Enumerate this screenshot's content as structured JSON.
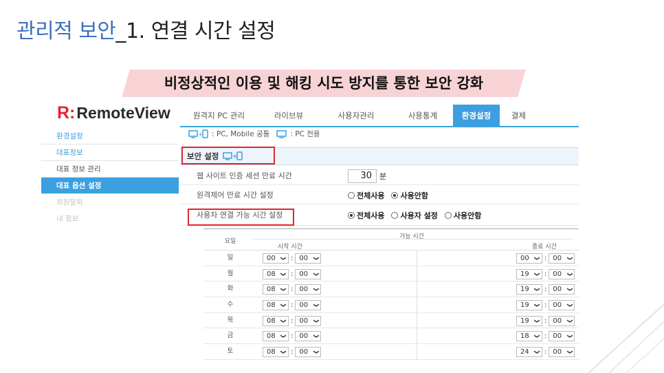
{
  "slide": {
    "title_part1": "관리적 보안",
    "title_part2": "_1. 연결 시간 설정",
    "banner": "비정상적인 이용 및 해킹 시도 방지를 통한 보안 강화"
  },
  "app": {
    "logo_mark": "R:",
    "logo_text": "RemoteView",
    "nav": [
      {
        "label": "원격지 PC 관리"
      },
      {
        "label": "라이브뷰"
      },
      {
        "label": "사용자관리"
      },
      {
        "label": "사용통계"
      },
      {
        "label": "환경설정",
        "active": true
      },
      {
        "label": "결제"
      }
    ],
    "sidebar": [
      {
        "label": "환경설정"
      },
      {
        "label": "대표정보"
      },
      {
        "label": "대표 정보 관리"
      },
      {
        "label": "대표 옵션 설정",
        "active": true
      },
      {
        "label": "회원탈퇴"
      },
      {
        "label": "내 정보"
      }
    ],
    "legend": {
      "common": ": PC, Mobile 공통",
      "pc_only": ": PC 전용"
    },
    "section_title": "보안 설정",
    "settings": [
      {
        "label": "웹 사이트 인증 세션 만료 시간",
        "value": "30",
        "unit": "분"
      },
      {
        "label": "원격제어 만료 시간 설정",
        "options": [
          "전체사용",
          "사용안함"
        ],
        "selected": "사용안함"
      },
      {
        "label": "사용자 연결 가능 시간 설정",
        "options": [
          "전체사용",
          "사용자 설정",
          "사용안함"
        ],
        "selected": "전체사용"
      }
    ],
    "schedule": {
      "col_day": "요일",
      "col_time": "가능 시간",
      "col_start": "시작 시간",
      "col_end": "종료 시간",
      "separator": ":",
      "rows": [
        {
          "day": "일",
          "start_h": "00",
          "start_m": "00",
          "end_h": "00",
          "end_m": "00"
        },
        {
          "day": "월",
          "start_h": "08",
          "start_m": "00",
          "end_h": "19",
          "end_m": "00"
        },
        {
          "day": "화",
          "start_h": "08",
          "start_m": "00",
          "end_h": "19",
          "end_m": "00"
        },
        {
          "day": "수",
          "start_h": "08",
          "start_m": "00",
          "end_h": "19",
          "end_m": "00"
        },
        {
          "day": "목",
          "start_h": "08",
          "start_m": "00",
          "end_h": "19",
          "end_m": "00"
        },
        {
          "day": "금",
          "start_h": "08",
          "start_m": "00",
          "end_h": "18",
          "end_m": "00"
        },
        {
          "day": "토",
          "start_h": "08",
          "start_m": "00",
          "end_h": "24",
          "end_m": "00"
        }
      ]
    }
  },
  "colors": {
    "accent": "#3c9fe0",
    "brand_red": "#e0272e",
    "title_blue": "#3d6fbd",
    "banner": "#f7d3d6"
  }
}
